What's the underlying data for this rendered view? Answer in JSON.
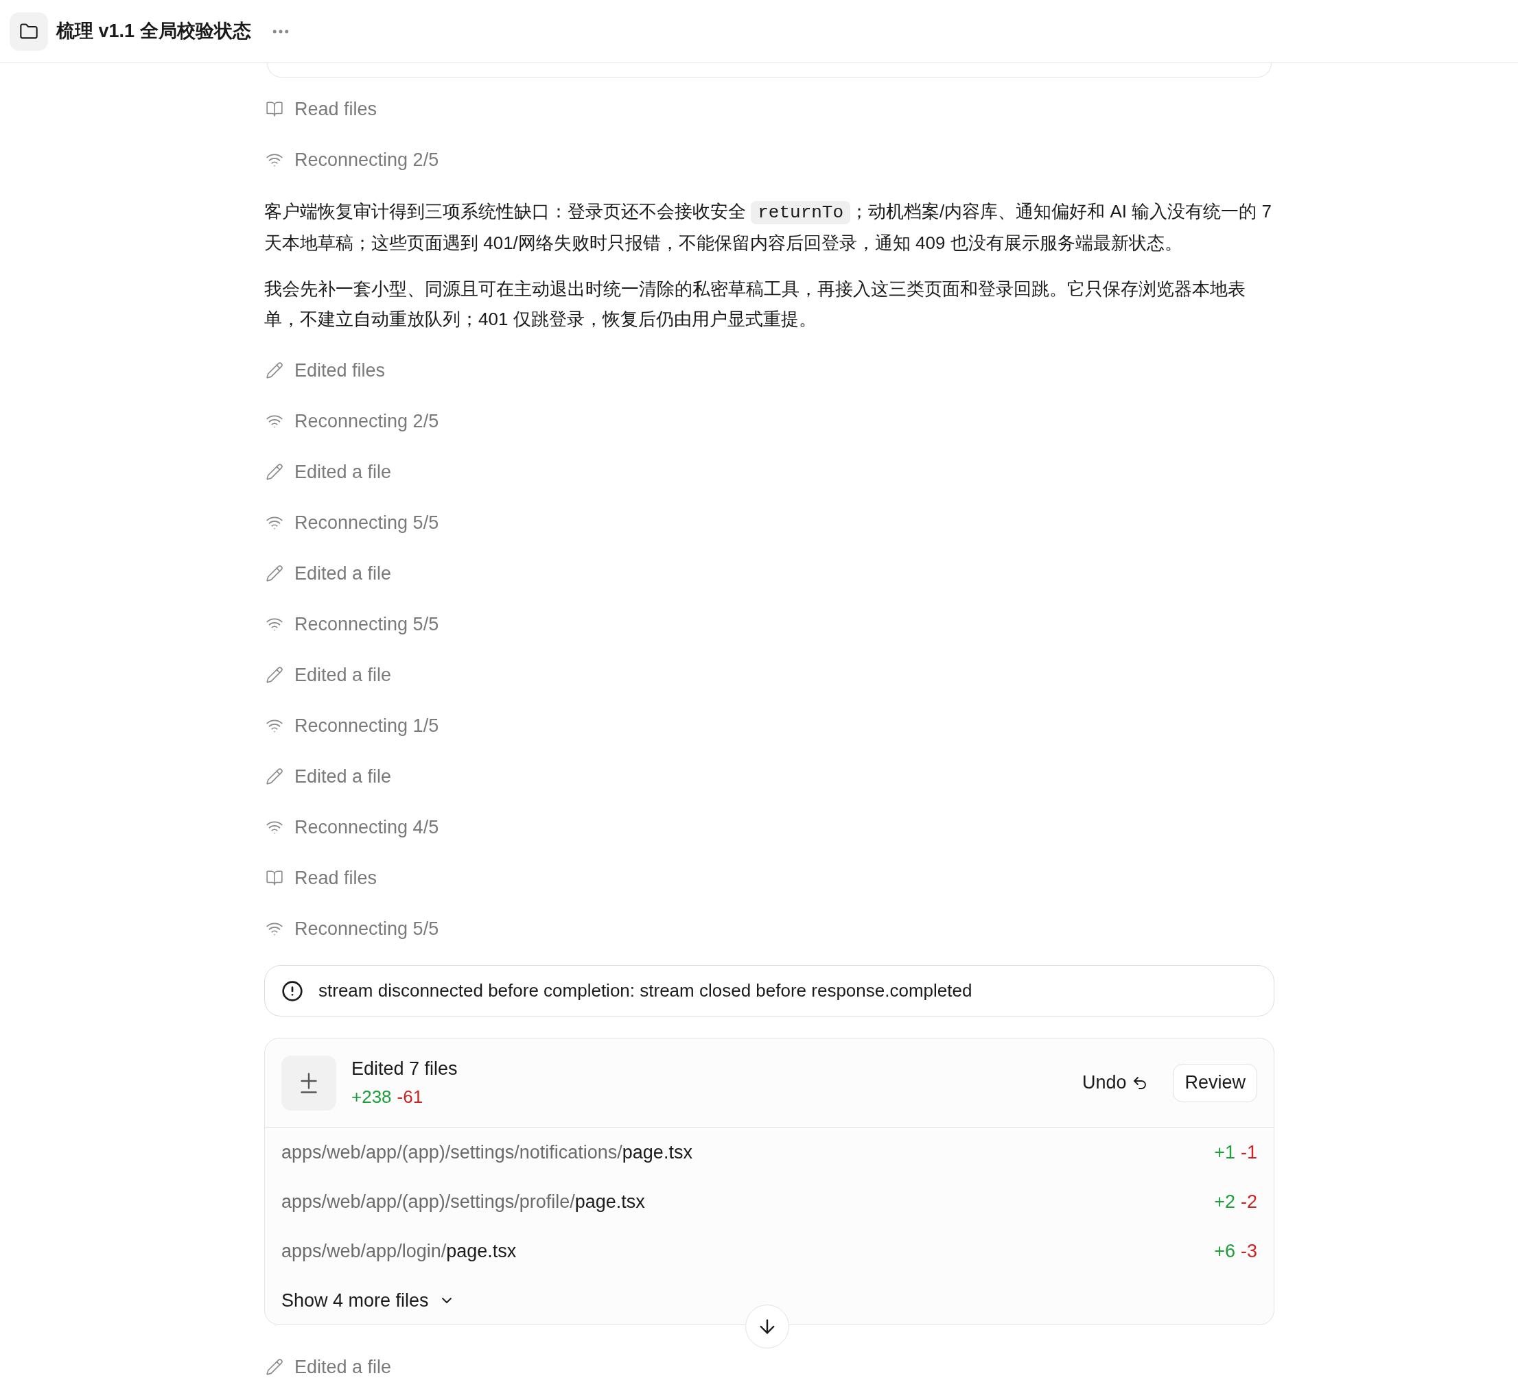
{
  "header": {
    "title": "梳理 v1.1 全局校验状态"
  },
  "activity_top": [
    {
      "kind": "read",
      "label": "Read files"
    },
    {
      "kind": "reconnect",
      "label": "Reconnecting 2/5"
    }
  ],
  "paragraphs": [
    {
      "before": "客户端恢复审计得到三项系统性缺口：登录页还不会接收安全 ",
      "code": "returnTo",
      "after": "；动机档案/内容库、通知偏好和 AI 输入没有统一的 7 天本地草稿；这些页面遇到 401/网络失败时只报错，不能保留内容后回登录，通知 409 也没有展示服务端最新状态。"
    },
    {
      "before": "我会先补一套小型、同源且可在主动退出时统一清除的私密草稿工具，再接入这三类页面和登录回跳。它只保存浏览器本地表单，不建立自动重放队列；401 仅跳登录，恢复后仍由用户显式重提。"
    }
  ],
  "activity": [
    {
      "kind": "edit",
      "label": "Edited files"
    },
    {
      "kind": "reconnect",
      "label": "Reconnecting 2/5"
    },
    {
      "kind": "edit",
      "label": "Edited a file"
    },
    {
      "kind": "reconnect",
      "label": "Reconnecting 5/5"
    },
    {
      "kind": "edit",
      "label": "Edited a file"
    },
    {
      "kind": "reconnect",
      "label": "Reconnecting 5/5"
    },
    {
      "kind": "edit",
      "label": "Edited a file"
    },
    {
      "kind": "reconnect",
      "label": "Reconnecting 1/5"
    },
    {
      "kind": "edit",
      "label": "Edited a file"
    },
    {
      "kind": "reconnect",
      "label": "Reconnecting 4/5"
    },
    {
      "kind": "read",
      "label": "Read files"
    },
    {
      "kind": "reconnect",
      "label": "Reconnecting 5/5"
    }
  ],
  "error": {
    "message": "stream disconnected before completion: stream closed before response.completed"
  },
  "changes": {
    "title": "Edited 7 files",
    "added": "+238",
    "removed": "-61",
    "undo": "Undo",
    "review": "Review",
    "files": [
      {
        "dir": "apps/web/app/(app)/settings/notifications/",
        "name": "page.tsx",
        "added": "+1",
        "removed": "-1"
      },
      {
        "dir": "apps/web/app/(app)/settings/profile/",
        "name": "page.tsx",
        "added": "+2",
        "removed": "-2"
      },
      {
        "dir": "apps/web/app/login/",
        "name": "page.tsx",
        "added": "+6",
        "removed": "-3"
      }
    ],
    "show_more": "Show 4 more files"
  },
  "activity_bottom": [
    {
      "kind": "edit",
      "label": "Edited a file"
    }
  ]
}
